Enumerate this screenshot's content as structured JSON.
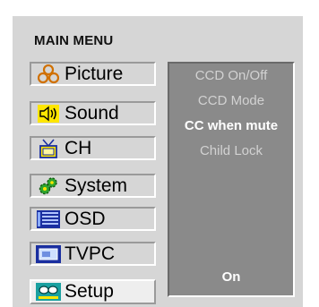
{
  "menu": {
    "title": "MAIN MENU",
    "items": [
      {
        "label": "Picture",
        "icon": "picture-icon"
      },
      {
        "label": "Sound",
        "icon": "speaker-icon"
      },
      {
        "label": "CH",
        "icon": "tv-icon"
      },
      {
        "label": "System",
        "icon": "gears-icon"
      },
      {
        "label": "OSD",
        "icon": "list-icon"
      },
      {
        "label": "TVPC",
        "icon": "monitor-icon"
      },
      {
        "label": "Setup",
        "icon": "setup-icon"
      }
    ],
    "selected": "Setup"
  },
  "panel": {
    "options": [
      "CCD On/Off",
      "CCD Mode",
      "CC when mute",
      "Child Lock"
    ],
    "active_option": "CC when mute",
    "value": "On"
  },
  "colors": {
    "frame": "#d6d6d6",
    "panel": "#8a8a8a",
    "selected_item": "#eeeeee"
  }
}
